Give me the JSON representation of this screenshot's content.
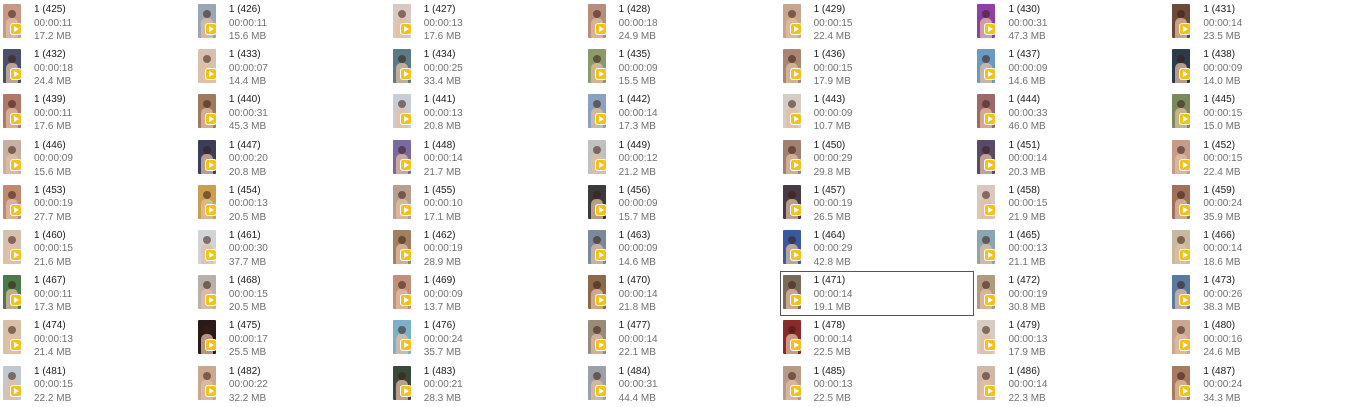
{
  "grid": {
    "selected_name": "1 (471)",
    "files": [
      {
        "name": "1 (425)",
        "duration": "00:00:11",
        "size": "17.2 MB",
        "thumb": "#c89a86"
      },
      {
        "name": "1 (426)",
        "duration": "00:00:11",
        "size": "15.6 MB",
        "thumb": "#9aa6b4"
      },
      {
        "name": "1 (427)",
        "duration": "00:00:13",
        "size": "17.6 MB",
        "thumb": "#d9c9c2"
      },
      {
        "name": "1 (428)",
        "duration": "00:00:18",
        "size": "24.9 MB",
        "thumb": "#b88d7a"
      },
      {
        "name": "1 (429)",
        "duration": "00:00:15",
        "size": "22.4 MB",
        "thumb": "#c8a58d"
      },
      {
        "name": "1 (430)",
        "duration": "00:00:31",
        "size": "47.3 MB",
        "thumb": "#8e3fa8"
      },
      {
        "name": "1 (431)",
        "duration": "00:00:14",
        "size": "23.5 MB",
        "thumb": "#6b4a3a"
      },
      {
        "name": "1 (432)",
        "duration": "00:00:18",
        "size": "24.4 MB",
        "thumb": "#4a4f6b"
      },
      {
        "name": "1 (433)",
        "duration": "00:00:07",
        "size": "14.4 MB",
        "thumb": "#d8c0ae"
      },
      {
        "name": "1 (434)",
        "duration": "00:00:25",
        "size": "33.4 MB",
        "thumb": "#5a7a86"
      },
      {
        "name": "1 (435)",
        "duration": "00:00:09",
        "size": "15.5 MB",
        "thumb": "#8a9a6a"
      },
      {
        "name": "1 (436)",
        "duration": "00:00:15",
        "size": "17.9 MB",
        "thumb": "#a88672"
      },
      {
        "name": "1 (437)",
        "duration": "00:00:09",
        "size": "14.6 MB",
        "thumb": "#6a9ac0"
      },
      {
        "name": "1 (438)",
        "duration": "00:00:09",
        "size": "14.0 MB",
        "thumb": "#2c3a4e"
      },
      {
        "name": "1 (439)",
        "duration": "00:00:11",
        "size": "17.6 MB",
        "thumb": "#b07868"
      },
      {
        "name": "1 (440)",
        "duration": "00:00:31",
        "size": "45.3 MB",
        "thumb": "#a07a60"
      },
      {
        "name": "1 (441)",
        "duration": "00:00:13",
        "size": "20.8 MB",
        "thumb": "#c8ccd6"
      },
      {
        "name": "1 (442)",
        "duration": "00:00:14",
        "size": "17.3 MB",
        "thumb": "#8aa2c0"
      },
      {
        "name": "1 (443)",
        "duration": "00:00:09",
        "size": "10.7 MB",
        "thumb": "#d6ccc6"
      },
      {
        "name": "1 (444)",
        "duration": "00:00:33",
        "size": "46.0 MB",
        "thumb": "#9a6a6a"
      },
      {
        "name": "1 (445)",
        "duration": "00:00:15",
        "size": "15.0 MB",
        "thumb": "#7a8a5a"
      },
      {
        "name": "1 (446)",
        "duration": "00:00:09",
        "size": "15.6 MB",
        "thumb": "#c8b0a0"
      },
      {
        "name": "1 (447)",
        "duration": "00:00:20",
        "size": "20.8 MB",
        "thumb": "#3a3e5a"
      },
      {
        "name": "1 (448)",
        "duration": "00:00:14",
        "size": "21.7 MB",
        "thumb": "#7a6aa0"
      },
      {
        "name": "1 (449)",
        "duration": "00:00:12",
        "size": "21.2 MB",
        "thumb": "#c0c0c0"
      },
      {
        "name": "1 (450)",
        "duration": "00:00:29",
        "size": "29.8 MB",
        "thumb": "#a08070"
      },
      {
        "name": "1 (451)",
        "duration": "00:00:14",
        "size": "20.3 MB",
        "thumb": "#5a4a6a"
      },
      {
        "name": "1 (452)",
        "duration": "00:00:15",
        "size": "22.4 MB",
        "thumb": "#c89a8a"
      },
      {
        "name": "1 (453)",
        "duration": "00:00:19",
        "size": "27.7 MB",
        "thumb": "#c08a70"
      },
      {
        "name": "1 (454)",
        "duration": "00:00:13",
        "size": "20.5 MB",
        "thumb": "#c8a050"
      },
      {
        "name": "1 (455)",
        "duration": "00:00:10",
        "size": "17.1 MB",
        "thumb": "#b8a090"
      },
      {
        "name": "1 (456)",
        "duration": "00:00:09",
        "size": "15.7 MB",
        "thumb": "#3a3a3a"
      },
      {
        "name": "1 (457)",
        "duration": "00:00:19",
        "size": "26.5 MB",
        "thumb": "#4a3a46"
      },
      {
        "name": "1 (458)",
        "duration": "00:00:15",
        "size": "21.9 MB",
        "thumb": "#d8c8c0"
      },
      {
        "name": "1 (459)",
        "duration": "00:00:24",
        "size": "35.9 MB",
        "thumb": "#a0705a"
      },
      {
        "name": "1 (460)",
        "duration": "00:00:15",
        "size": "21.6 MB",
        "thumb": "#d8c0b0"
      },
      {
        "name": "1 (461)",
        "duration": "00:00:30",
        "size": "37.7 MB",
        "thumb": "#d0d4d8"
      },
      {
        "name": "1 (462)",
        "duration": "00:00:19",
        "size": "28.9 MB",
        "thumb": "#a08060"
      },
      {
        "name": "1 (463)",
        "duration": "00:00:09",
        "size": "14.6 MB",
        "thumb": "#7a8a9a"
      },
      {
        "name": "1 (464)",
        "duration": "00:00:29",
        "size": "42.8 MB",
        "thumb": "#3a5aa0"
      },
      {
        "name": "1 (465)",
        "duration": "00:00:13",
        "size": "21.1 MB",
        "thumb": "#8aa6b0"
      },
      {
        "name": "1 (466)",
        "duration": "00:00:14",
        "size": "18.6 MB",
        "thumb": "#c8b8a0"
      },
      {
        "name": "1 (467)",
        "duration": "00:00:11",
        "size": "17.3 MB",
        "thumb": "#4a7a4a"
      },
      {
        "name": "1 (468)",
        "duration": "00:00:15",
        "size": "20.5 MB",
        "thumb": "#b8b0aa"
      },
      {
        "name": "1 (469)",
        "duration": "00:00:09",
        "size": "13.7 MB",
        "thumb": "#c0907a"
      },
      {
        "name": "1 (470)",
        "duration": "00:00:14",
        "size": "21.8 MB",
        "thumb": "#8a6a4a"
      },
      {
        "name": "1 (471)",
        "duration": "00:00:14",
        "size": "19.1 MB",
        "thumb": "#7a6a5a"
      },
      {
        "name": "1 (472)",
        "duration": "00:00:19",
        "size": "30.8 MB",
        "thumb": "#b09a80"
      },
      {
        "name": "1 (473)",
        "duration": "00:00:26",
        "size": "38.3 MB",
        "thumb": "#5a7aa0"
      },
      {
        "name": "1 (474)",
        "duration": "00:00:13",
        "size": "21.4 MB",
        "thumb": "#d8c0a8"
      },
      {
        "name": "1 (475)",
        "duration": "00:00:17",
        "size": "25.5 MB",
        "thumb": "#2a1a1a"
      },
      {
        "name": "1 (476)",
        "duration": "00:00:24",
        "size": "35.7 MB",
        "thumb": "#7ab0c8"
      },
      {
        "name": "1 (477)",
        "duration": "00:00:14",
        "size": "22.1 MB",
        "thumb": "#9a8a7a"
      },
      {
        "name": "1 (478)",
        "duration": "00:00:14",
        "size": "22.5 MB",
        "thumb": "#8a2a2a"
      },
      {
        "name": "1 (479)",
        "duration": "00:00:13",
        "size": "17.9 MB",
        "thumb": "#d8ccc0"
      },
      {
        "name": "1 (480)",
        "duration": "00:00:16",
        "size": "24.6 MB",
        "thumb": "#c8a890"
      },
      {
        "name": "1 (481)",
        "duration": "00:00:15",
        "size": "22.2 MB",
        "thumb": "#c0c8d0"
      },
      {
        "name": "1 (482)",
        "duration": "00:00:22",
        "size": "32.2 MB",
        "thumb": "#c8a890"
      },
      {
        "name": "1 (483)",
        "duration": "00:00:21",
        "size": "28.3 MB",
        "thumb": "#3a4a3a"
      },
      {
        "name": "1 (484)",
        "duration": "00:00:31",
        "size": "44.4 MB",
        "thumb": "#9aa0a6"
      },
      {
        "name": "1 (485)",
        "duration": "00:00:13",
        "size": "22.5 MB",
        "thumb": "#b89a88"
      },
      {
        "name": "1 (486)",
        "duration": "00:00:14",
        "size": "22.3 MB",
        "thumb": "#d0b8a8"
      },
      {
        "name": "1 (487)",
        "duration": "00:00:24",
        "size": "34.3 MB",
        "thumb": "#a87a60"
      }
    ]
  },
  "icons": {
    "thumbnail": "video-thumbnail-icon",
    "play": "play-badge-icon"
  },
  "colors": {
    "play_badge": "#f2c21b",
    "selection_border": "#555555",
    "secondary_text": "#707070"
  }
}
